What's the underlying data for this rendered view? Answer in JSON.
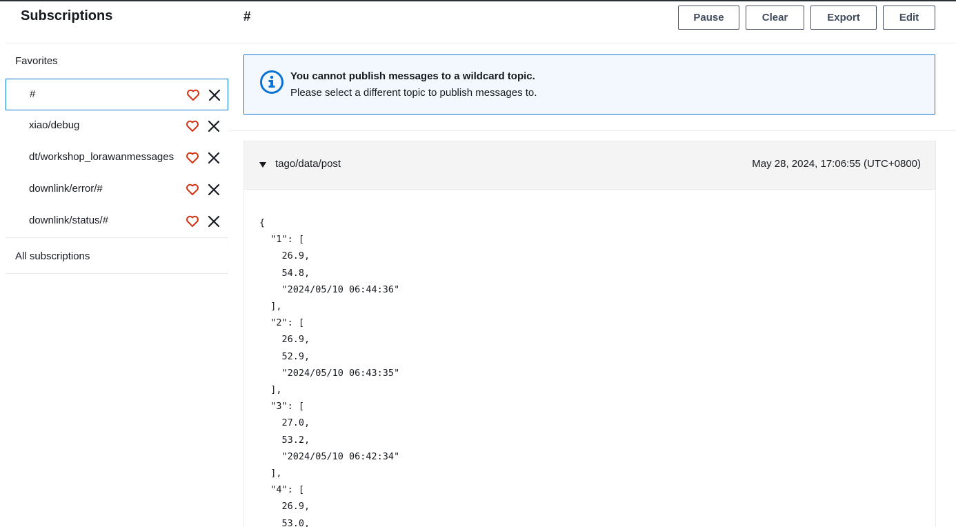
{
  "sidebar": {
    "title": "Subscriptions",
    "favorites_label": "Favorites",
    "all_subscriptions_label": "All subscriptions",
    "items": [
      {
        "label": "#",
        "selected": true
      },
      {
        "label": "xiao/debug"
      },
      {
        "label": "dt/workshop_lorawanmessages"
      },
      {
        "label": "downlink/error/#"
      },
      {
        "label": "downlink/status/#"
      }
    ]
  },
  "main": {
    "topic_title": "#",
    "toolbar": {
      "pause": "Pause",
      "clear": "Clear",
      "export": "Export",
      "edit": "Edit"
    },
    "alert": {
      "title": "You cannot publish messages to a wildcard topic.",
      "body": "Please select a different topic to publish messages to."
    },
    "message": {
      "topic": "tago/data/post",
      "timestamp": "May 28, 2024, 17:06:55 (UTC+0800)",
      "payload_lines": [
        "{",
        "  \"1\": [",
        "    26.9,",
        "    54.8,",
        "    \"2024/05/10 06:44:36\"",
        "  ],",
        "  \"2\": [",
        "    26.9,",
        "    52.9,",
        "    \"2024/05/10 06:43:35\"",
        "  ],",
        "  \"3\": [",
        "    27.0,",
        "    53.2,",
        "    \"2024/05/10 06:42:34\"",
        "  ],",
        "  \"4\": [",
        "    26.9,",
        "    53.0,"
      ]
    }
  },
  "colors": {
    "accent": "#0972d3",
    "heart": "#d13212",
    "alert_bg": "#f2f8fd"
  },
  "icons": {
    "favorite": "heart-icon",
    "remove": "close-icon",
    "info": "info-icon",
    "expand": "caret-down-icon"
  }
}
